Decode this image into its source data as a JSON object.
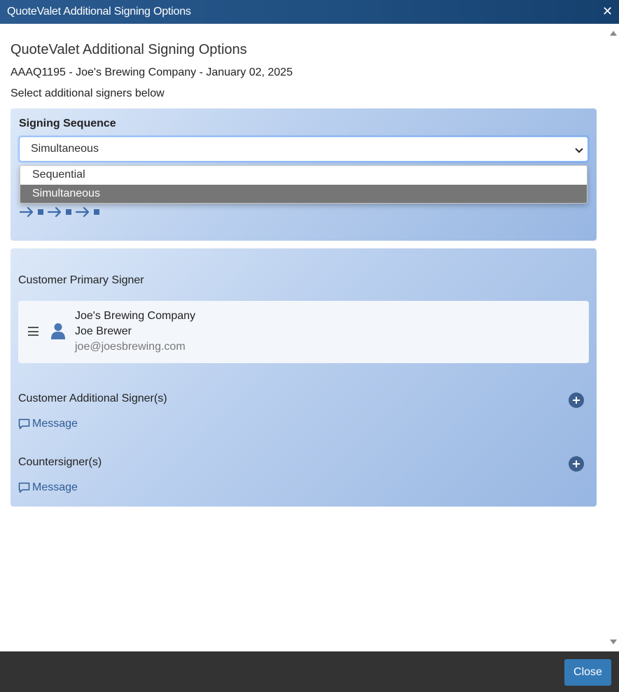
{
  "window": {
    "title": "QuoteValet Additional Signing Options"
  },
  "header": {
    "title": "QuoteValet Additional Signing Options",
    "quote_info": "AAAQ1195 - Joe's Brewing Company - January 02, 2025",
    "instructions": "Select additional signers below"
  },
  "sequence": {
    "label": "Signing Sequence",
    "selected": "Simultaneous",
    "options": [
      "Sequential",
      "Simultaneous"
    ]
  },
  "primary": {
    "label": "Customer Primary Signer",
    "company": "Joe's Brewing Company",
    "name": "Joe Brewer",
    "email": "joe@joesbrewing.com"
  },
  "additional": {
    "label": "Customer Additional Signer(s)",
    "message": "Message"
  },
  "countersigners": {
    "label": "Countersigner(s)",
    "message": "Message"
  },
  "footer": {
    "close": "Close"
  },
  "colors": {
    "titlebar": "#1f4f80",
    "accent": "#337ab7",
    "link": "#2f5c96",
    "panel_light": "#dce8f8",
    "panel_dark": "#97b6e2",
    "selected_option": "#767676"
  }
}
